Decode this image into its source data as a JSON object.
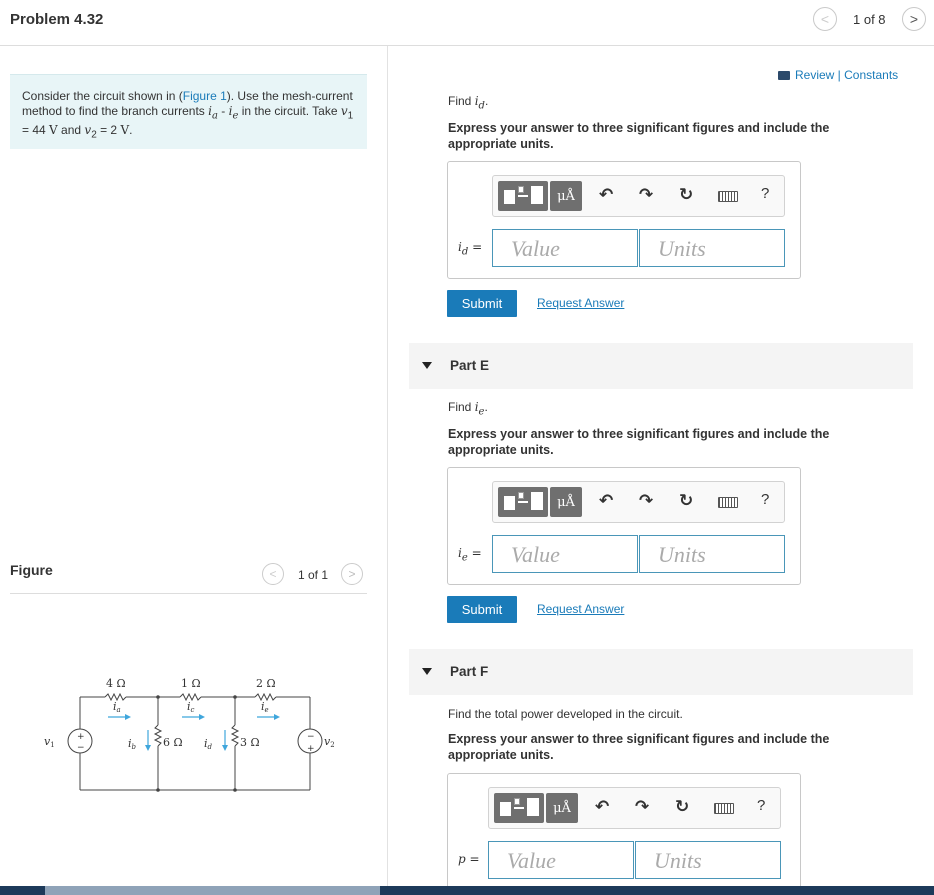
{
  "header": {
    "title": "Problem 4.32",
    "page_indicator": "1 of 8",
    "prev_icon": "chevron-left-icon",
    "next_icon": "chevron-right-icon"
  },
  "problem": {
    "text_1": "Consider the circuit shown in (",
    "figure_link": "Figure 1",
    "text_2": "). Use the mesh-current method to find the branch currents ",
    "ia": "i",
    "ia_sub": "a",
    "dash": " - ",
    "ie": "i",
    "ie_sub": "e",
    "text_3": " in the circuit. Take ",
    "v1": "v",
    "v1_sub": "1",
    "v1_val": " = 44 ",
    "unit_v": "V",
    "and": " and ",
    "v2": "v",
    "v2_sub": "2",
    "v2_val": " = 2 ",
    "end": "."
  },
  "figure": {
    "label": "Figure",
    "page_indicator": "1 of 1",
    "circuit": {
      "r1": "4 Ω",
      "r2": "1 Ω",
      "r3": "2 Ω",
      "r4": "6 Ω",
      "r5": "3 Ω",
      "ia": "i",
      "ia_sub": "a",
      "ic": "i",
      "ic_sub": "c",
      "ie": "i",
      "ie_sub": "e",
      "ib": "i",
      "ib_sub": "b",
      "id": "i",
      "id_sub": "d",
      "v1": "v",
      "v1_sub": "1",
      "v2": "v",
      "v2_sub": "2",
      "plus": "+",
      "minus": "−"
    }
  },
  "review": "Review | Constants",
  "part_d": {
    "find_text": "Find ",
    "find_var": "i",
    "find_sub": "d",
    "find_end": ".",
    "instruction": "Express your answer to three significant figures and include the appropriate units.",
    "var_label": "i",
    "var_sub": "d",
    "eq": " =",
    "value_placeholder": "Value",
    "units_placeholder": "Units",
    "submit": "Submit",
    "request": "Request Answer"
  },
  "part_e": {
    "label": "Part E",
    "find_text": "Find ",
    "find_var": "i",
    "find_sub": "e",
    "find_end": ".",
    "instruction": "Express your answer to three significant figures and include the appropriate units.",
    "var_label": "i",
    "var_sub": "e",
    "eq": " =",
    "value_placeholder": "Value",
    "units_placeholder": "Units",
    "submit": "Submit",
    "request": "Request Answer"
  },
  "part_f": {
    "label": "Part F",
    "find_text": "Find the total power developed in the circuit.",
    "instruction": "Express your answer to three significant figures and include the appropriate units.",
    "var_label": "p",
    "eq": " =",
    "value_placeholder": "Value",
    "units_placeholder": "Units"
  },
  "toolbar": {
    "units_btn": "μÅ",
    "undo_icon": "undo-icon",
    "redo_icon": "redo-icon",
    "reset_icon": "reset-icon",
    "keyboard_icon": "keyboard-icon",
    "help": "?"
  },
  "colors": {
    "accent": "#1a7bb9",
    "problem_bg": "#e8f5f7",
    "part_bg": "#f4f4f4",
    "input_border": "#4a96b8"
  }
}
